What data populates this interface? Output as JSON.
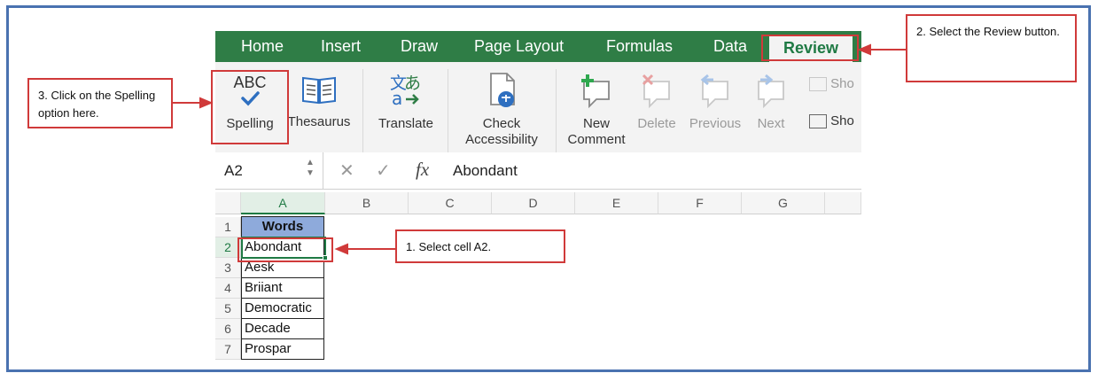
{
  "tabs": [
    "Home",
    "Insert",
    "Draw",
    "Page Layout",
    "Formulas",
    "Data",
    "Review"
  ],
  "active_tab": "Review",
  "ribbon": {
    "spelling": {
      "glyph": "ABC",
      "label": "Spelling"
    },
    "thesaurus": {
      "label": "Thesaurus"
    },
    "translate": {
      "label": "Translate"
    },
    "check_accessibility": {
      "line1": "Check",
      "line2": "Accessibility"
    },
    "new_comment": {
      "line1": "New",
      "line2": "Comment"
    },
    "delete": {
      "label": "Delete"
    },
    "previous": {
      "label": "Previous"
    },
    "next": {
      "label": "Next"
    },
    "show1": {
      "label": "Sho"
    },
    "show2": {
      "label": "Sho"
    }
  },
  "formula_bar": {
    "name_box": "A2",
    "fx": "fx",
    "value": "Abondant"
  },
  "columns": [
    "A",
    "B",
    "C",
    "D",
    "E",
    "F",
    "G"
  ],
  "rows": [
    "1",
    "2",
    "3",
    "4",
    "5",
    "6",
    "7"
  ],
  "cells": [
    "Words",
    "Abondant",
    "Aesk",
    "Briiant",
    "Democratic",
    "Decade",
    "Prospar"
  ],
  "annotations": {
    "step1": "1. Select cell A2.",
    "step2": "2. Select the Review button.",
    "step3": "3. Click on the Spelling option here."
  },
  "colors": {
    "excel_green": "#2f7d46",
    "header_fill": "#8eaadb",
    "annotation_red": "#d03a3a",
    "frame_blue": "#4a72b0"
  }
}
